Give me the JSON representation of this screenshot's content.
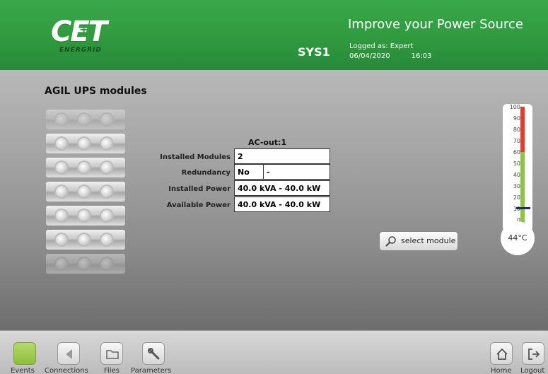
{
  "header": {
    "logo_text": "CET",
    "logo_sub": "ENERGRID",
    "system_name": "SYS1",
    "tagline": "Improve your Power Source",
    "logged_as": "Logged as: Expert",
    "date": "06/04/2020",
    "time": "16:03"
  },
  "page": {
    "title": "AGIL UPS modules"
  },
  "ac_out": {
    "title": "AC-out:1",
    "rows": [
      {
        "label": "Installed Modules",
        "value": "2"
      },
      {
        "label": "Redundancy",
        "value": "No",
        "extra": "-"
      },
      {
        "label": "Installed Power",
        "value": "40.0 kVA - 40.0 kW"
      },
      {
        "label": "Available Power",
        "value": "40.0 kVA - 40.0 kW"
      }
    ]
  },
  "actions": {
    "select_module": "select module"
  },
  "thermometer": {
    "ticks": [
      "100",
      "90",
      "80",
      "70",
      "60",
      "50",
      "40",
      "30",
      "20",
      "10",
      "0"
    ],
    "reading": "44°C",
    "value": 44,
    "colors": {
      "high": "#e23b2e",
      "normal": "#8cc63f",
      "marker": "#1a2d6b"
    }
  },
  "footer": {
    "events": "Events",
    "connections": "Connections",
    "files": "Files",
    "parameters": "Parameters",
    "home": "Home",
    "logout": "Logout"
  },
  "colors": {
    "header_green": "#2f9a3e",
    "active_green": "#8cbf3d"
  }
}
